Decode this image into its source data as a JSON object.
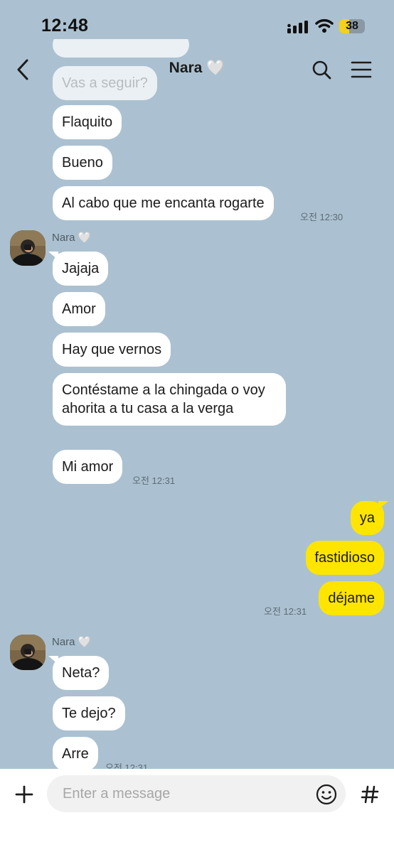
{
  "status": {
    "time": "12:48",
    "battery": "38",
    "battery_level": 0.38
  },
  "header": {
    "title": "Nara 🤍"
  },
  "messages": {
    "faded_1": "Vas a seguir?",
    "b1": "Flaquito",
    "b2": "Bueno",
    "b3": "Al cabo que me encanta rogarte",
    "t1": "오전 12:30",
    "sender1": "Nara 🤍",
    "r1": "Jajaja",
    "r2": "Amor",
    "r3": "Hay que vernos",
    "r4": "Contéstame a la chingada o voy ahorita a tu casa a la verga",
    "r5": "Mi amor",
    "t2": "오전 12:31",
    "s1": "ya",
    "s2": "fastidioso",
    "s3": "déjame",
    "t3": "오전 12:31",
    "sender2": "Nara 🤍",
    "q1": "Neta?",
    "q2": "Te dejo?",
    "q3": "Arre",
    "t4": "오전 12:31"
  },
  "input": {
    "placeholder": "Enter a message"
  },
  "colors": {
    "background": "#abc1d1",
    "my_bubble": "#fee500",
    "their_bubble": "#ffffff"
  }
}
